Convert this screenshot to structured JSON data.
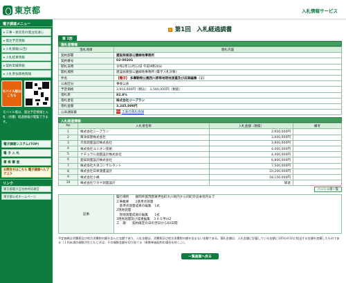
{
  "header": {
    "logo_text": "東京都",
    "service_title": "入札情報サービス"
  },
  "sidebar": {
    "heading": "電子調達メニュー",
    "items": [
      "工事・委託等の発注見通し",
      "発注予定情報",
      "入札情報(公告)",
      "入札結果情報",
      "契約実績情報",
      "入札参加資格情報"
    ],
    "mobile": {
      "button_label": "モバイル版はこちら",
      "note": "モバイル版は、発注予定情報と入札（見積）経過情報が閲覧できます。"
    },
    "blocks": [
      "電子調達システム(TOP)",
      "電 子 入 札",
      "資 格 審 査"
    ],
    "inquiry": "お問合せはこちら 電子調達ヘルプデスク",
    "links_heading": "リンク",
    "links": [
      "東京都電子自治体共同運営",
      "東京都公式ホームページ"
    ]
  },
  "main": {
    "title": "第1回　入札経過調書",
    "round_tab": "第 1回",
    "contract_section": "落札者情報",
    "col_item": "落札項目",
    "col_value": "落札内容",
    "contract_rows": [
      {
        "k": "契約部署",
        "v": "建設局東部公園緑地事務所"
      },
      {
        "k": "契約番号",
        "v": "02-00201"
      },
      {
        "k": "開札日時",
        "v": "令和2年11月12日 午前9時30分"
      },
      {
        "k": "開札場所",
        "v": "建設局東部公園緑地事務所 (電子入札対象)"
      },
      {
        "k": "件名",
        "v_red": "【電子】",
        "v": "多摩動物公園西川原等地現地測量及び成果編集（２）"
      },
      {
        "k": "公表区分",
        "v": "事後公表"
      },
      {
        "k": "予定価格",
        "v": "3,916,000円（税込）　3,560,000円（税抜）"
      },
      {
        "k": "落札率",
        "v": "82.8%"
      },
      {
        "k": "落札者名",
        "v": "株式会社ジープラン"
      },
      {
        "k": "落札金額",
        "v": "3,245,000円"
      },
      {
        "k": "公表通知書",
        "v": "工事の落札情報"
      }
    ],
    "bids_section": "入札経過情報",
    "bid_headers": {
      "no": "No",
      "name": "入札者名称",
      "amount": "入札金額（税抜）",
      "note": "備考"
    },
    "bids": [
      {
        "no": "1",
        "name": "株式会社ジープラン",
        "amount": "2,950,000円",
        "note": ""
      },
      {
        "no": "2",
        "name": "東洋技建株式会社",
        "amount": "3,600,000円",
        "note": ""
      },
      {
        "no": "3",
        "name": "大和測量設計株式会社",
        "amount": "3,800,000円",
        "note": ""
      },
      {
        "no": "4",
        "name": "株式会社ユニオン技術",
        "amount": "4,000,000円",
        "note": ""
      },
      {
        "no": "5",
        "name": "ナチュラル測量設計株式会社",
        "amount": "4,400,000円",
        "note": ""
      },
      {
        "no": "6",
        "name": "愛知測量設計株式会社",
        "amount": "6,800,000円",
        "note": ""
      },
      {
        "no": "7",
        "name": "株式会社大洋コンサルタント",
        "amount": "7,500,000円",
        "note": ""
      },
      {
        "no": "8",
        "name": "株式会社日栄測量設計",
        "amount": "10,200,000円",
        "note": ""
      },
      {
        "no": "9",
        "name": "株式会社小嶋",
        "amount": "18,150,000円",
        "note": ""
      },
      {
        "no": "10",
        "name": "株式会社ワカヤ測量設計",
        "amount": "辞退",
        "note": ""
      }
    ],
    "history_button": "ハッシュ値一覧",
    "remarks_label": "記事",
    "remarks_text": "履行場所　　静岡県賀茂郡東伊豆町大川地内から同町奈良本地内まで\n工事概要　　1基準点測量\n　基準点測量成果の編集　1式\n2現地測量\n　現地測量成果の編集　　1式\n3現地測量及び成果編集　３６０平ｍ2\n工　期　　契約確定の日の翌日から60日間",
    "footnote": "予定価格は消費税及び地方消費税の額を含んだ金額であり、入札金額は、消費税及び地方消費税の額を含まない金額である。落札金額は、入札金額に記載している金額に100分の10に相当する金額を加算したものである（１円未満の端数が生じたときは、その端数金額を切り捨てる（単数単価契約の場合を除く。））。",
    "back_button": "一覧画面へ戻る"
  }
}
